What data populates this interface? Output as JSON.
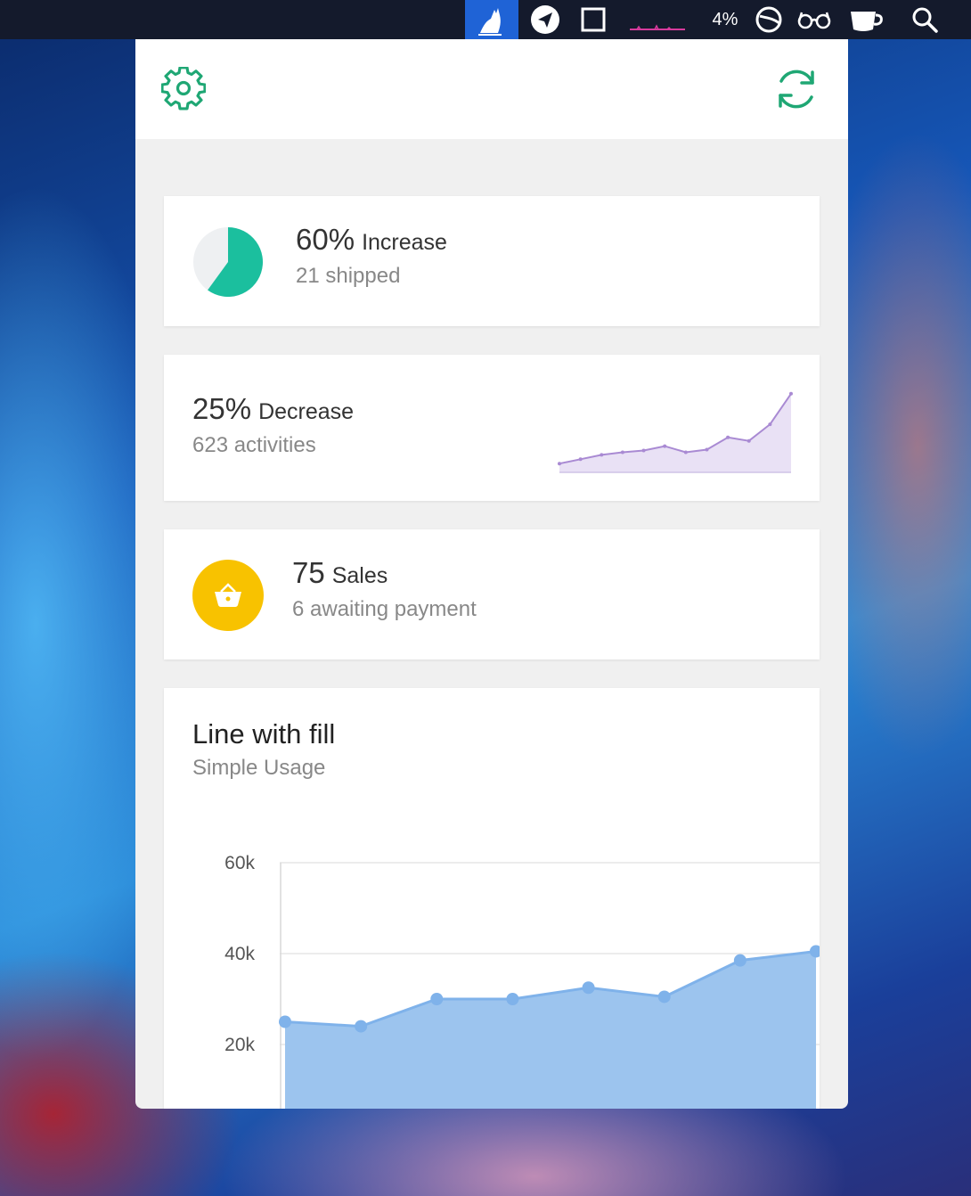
{
  "menubar": {
    "cpu_percent": "4%",
    "icons": [
      "cat-icon",
      "send-icon",
      "square-icon",
      "activity-graph-icon",
      "moon-icon",
      "glasses-icon",
      "coffee-cup-icon",
      "search-icon"
    ],
    "active_color": "#1f63d6"
  },
  "header": {
    "settings_icon": "gear-icon",
    "refresh_icon": "refresh-icon",
    "accent": "#1fa774"
  },
  "cards": {
    "shipped": {
      "value": "60%",
      "unit": "Increase",
      "sub": "21 shipped",
      "pie_fraction": 0.6,
      "pie_color": "#1bbf9e"
    },
    "activities": {
      "value": "25%",
      "unit": "Decrease",
      "sub": "623 activities",
      "spark_color": "#a98ad3",
      "spark_fill": "#e9e1f5"
    },
    "sales": {
      "value": "75",
      "unit": "Sales",
      "sub": "6 awaiting payment",
      "icon": "basket-icon",
      "icon_bg": "#f8c200"
    }
  },
  "line_chart": {
    "title": "Line with fill",
    "subtitle": "Simple Usage"
  },
  "chart_data": [
    {
      "type": "area",
      "title": "",
      "x": [
        1,
        2,
        3,
        4,
        5,
        6,
        7,
        8,
        9,
        10,
        11,
        12
      ],
      "series": [
        {
          "values": [
            10,
            15,
            20,
            23,
            25,
            30,
            23,
            26,
            40,
            36,
            55,
            90
          ]
        }
      ],
      "ylim": [
        0,
        100
      ],
      "color": "#a98ad3"
    },
    {
      "type": "area",
      "title": "Line with fill",
      "subtitle": "Simple Usage",
      "x": [
        1,
        2,
        3,
        4,
        5,
        6,
        7,
        8
      ],
      "series": [
        {
          "values": [
            25000,
            24000,
            30000,
            30000,
            32500,
            30500,
            38500,
            40500
          ]
        }
      ],
      "yticks": [
        "60k",
        "40k",
        "20k"
      ],
      "ylim": [
        0,
        60000
      ],
      "grid": true,
      "color": "#7fb2ea",
      "fill": "#9cc4ee"
    }
  ]
}
